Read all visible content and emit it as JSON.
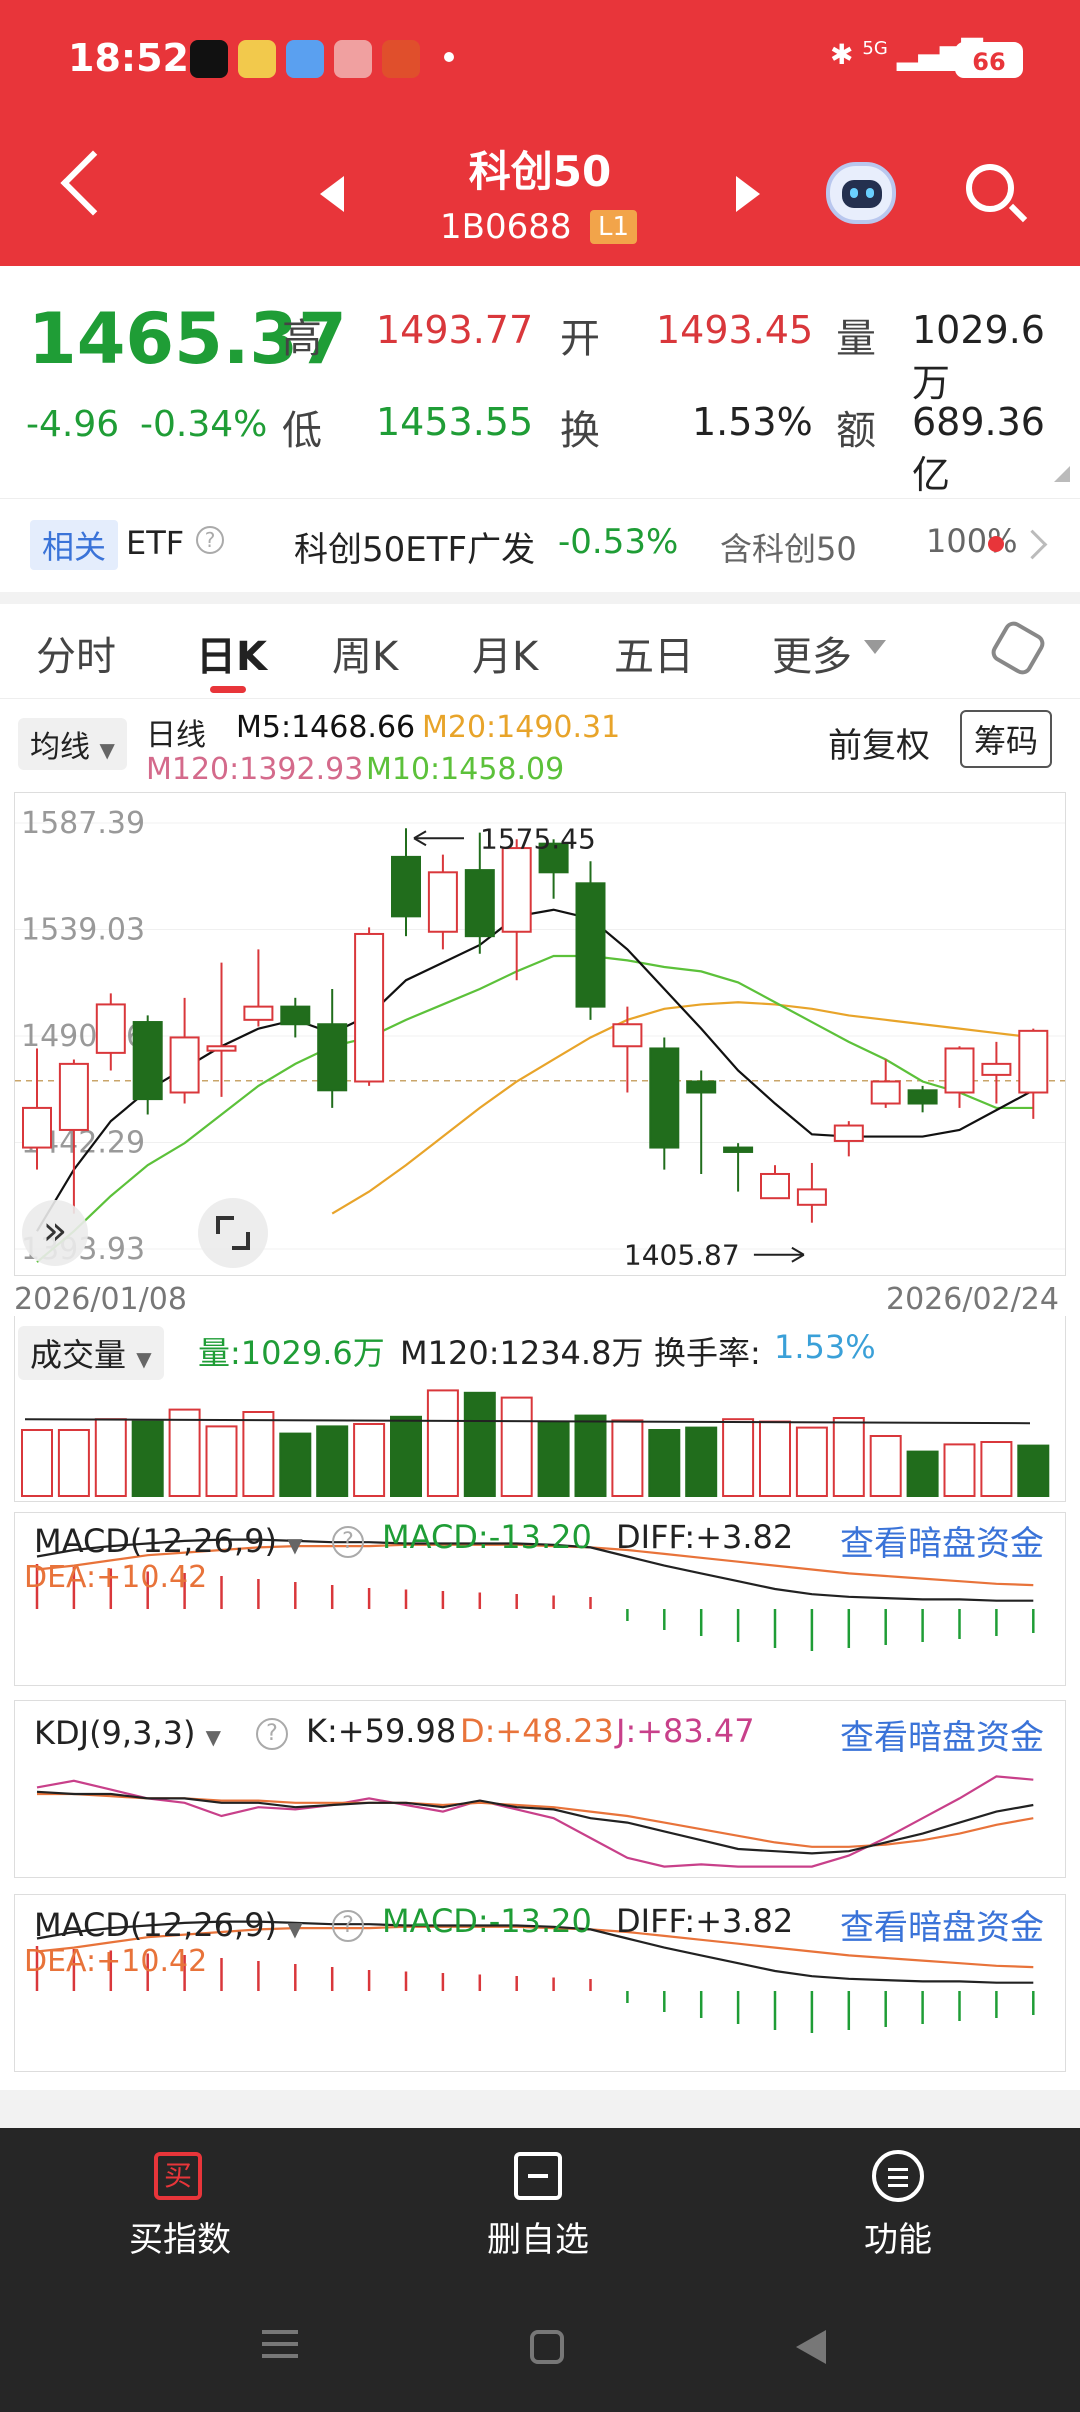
{
  "status": {
    "time": "18:52",
    "network": "5G",
    "battery": "66"
  },
  "header": {
    "title": "科创50",
    "code": "1B0688",
    "level": "L1"
  },
  "quote": {
    "price": "1465.37",
    "change": "-4.96",
    "change_pct": "-0.34%",
    "high_label": "高",
    "high": "1493.77",
    "open_label": "开",
    "open": "1493.45",
    "volume_label": "量",
    "volume": "1029.6万",
    "low_label": "低",
    "low": "1453.55",
    "turnover_label": "换",
    "turnover": "1.53%",
    "amount_label": "额",
    "amount": "689.36亿"
  },
  "etf": {
    "tag": "相关",
    "etf_label": "ETF",
    "name": "科创50ETF广发",
    "change": "-0.53%",
    "contains": "含科创50",
    "contains_pct": "100%"
  },
  "tabs": [
    "分时",
    "日K",
    "周K",
    "月K",
    "五日",
    "更多"
  ],
  "ma": {
    "selector": "均线",
    "period": "日线",
    "m5": "M5:1468.66",
    "m20": "M20:1490.31",
    "m120": "M120:1392.93",
    "m10": "M10:1458.09",
    "adj": "前复权",
    "chips": "筹码"
  },
  "colors": {
    "up": "#d9373b",
    "down": "#216d1c",
    "m5": "#111111",
    "m10": "#5cc13a",
    "m20": "#e8a42a",
    "m120": "#d46a8b",
    "header": "#e8353a"
  },
  "kline": {
    "start_date": "2026/01/08",
    "end_date": "2026/02/24",
    "high_mark": "1575.45",
    "low_mark": "1405.87"
  },
  "volume": {
    "selector": "成交量",
    "vol": "量:1029.6万",
    "m120": "M120:1234.8万",
    "turnover_label": "换手率:",
    "turnover": "1.53%"
  },
  "macd": {
    "selector": "MACD(12,26,9)",
    "macd": "MACD:-13.20",
    "diff": "DIFF:+3.82",
    "dea": "DEA:+10.42",
    "link": "查看暗盘资金"
  },
  "kdj": {
    "selector": "KDJ(9,3,3)",
    "k": "K:+59.98",
    "d": "D:+48.23",
    "j": "J:+83.47",
    "link": "查看暗盘资金"
  },
  "bottom_nav": {
    "buy_icon": "买",
    "buy": "买指数",
    "remove": "删自选",
    "func": "功能"
  },
  "chart_data": {
    "type": "candlestick",
    "x_start": "2026/01/08",
    "x_end": "2026/02/24",
    "y_ticks": [
      1587.39,
      1539.03,
      1490.66,
      1442.29,
      1393.93
    ],
    "ylim": [
      1393.93,
      1587.39
    ],
    "reference_price": 1470.33,
    "candles": [
      {
        "o": 1440,
        "c": 1458,
        "h": 1485,
        "l": 1430
      },
      {
        "o": 1448,
        "c": 1478,
        "h": 1480,
        "l": 1410
      },
      {
        "o": 1483,
        "c": 1505,
        "h": 1510,
        "l": 1475
      },
      {
        "o": 1497,
        "c": 1462,
        "h": 1500,
        "l": 1455
      },
      {
        "o": 1465,
        "c": 1490,
        "h": 1508,
        "l": 1460
      },
      {
        "o": 1484,
        "c": 1486,
        "h": 1524,
        "l": 1463
      },
      {
        "o": 1498,
        "c": 1504,
        "h": 1530,
        "l": 1495
      },
      {
        "o": 1504,
        "c": 1496,
        "h": 1508,
        "l": 1490
      },
      {
        "o": 1496,
        "c": 1466,
        "h": 1512,
        "l": 1458
      },
      {
        "o": 1470,
        "c": 1537,
        "h": 1540,
        "l": 1468
      },
      {
        "o": 1572,
        "c": 1545,
        "h": 1585,
        "l": 1536
      },
      {
        "o": 1538,
        "c": 1565,
        "h": 1573,
        "l": 1530
      },
      {
        "o": 1566,
        "c": 1536,
        "h": 1583,
        "l": 1528
      },
      {
        "o": 1538,
        "c": 1576,
        "h": 1580,
        "l": 1516
      },
      {
        "o": 1578,
        "c": 1565,
        "h": 1580,
        "l": 1553
      },
      {
        "o": 1560,
        "c": 1504,
        "h": 1570,
        "l": 1498
      },
      {
        "o": 1486,
        "c": 1496,
        "h": 1504,
        "l": 1465
      },
      {
        "o": 1485,
        "c": 1440,
        "h": 1490,
        "l": 1430
      },
      {
        "o": 1470,
        "c": 1465,
        "h": 1475,
        "l": 1428
      },
      {
        "o": 1440,
        "c": 1438,
        "h": 1442,
        "l": 1420
      },
      {
        "o": 1417,
        "c": 1428,
        "h": 1432,
        "l": 1417
      },
      {
        "o": 1414,
        "c": 1421,
        "h": 1433,
        "l": 1405.87
      },
      {
        "o": 1443,
        "c": 1450,
        "h": 1452,
        "l": 1436
      },
      {
        "o": 1460,
        "c": 1470,
        "h": 1480,
        "l": 1458
      },
      {
        "o": 1466,
        "c": 1460,
        "h": 1468,
        "l": 1456
      },
      {
        "o": 1465,
        "c": 1485,
        "h": 1486,
        "l": 1458
      },
      {
        "o": 1473,
        "c": 1478,
        "h": 1488,
        "l": 1460
      },
      {
        "o": 1465,
        "c": 1493,
        "h": 1494,
        "l": 1453
      }
    ],
    "ma5": [
      1402,
      1430,
      1452,
      1466,
      1476,
      1486,
      1494,
      1498,
      1492,
      1500,
      1516,
      1524,
      1532,
      1545,
      1548,
      1544,
      1530,
      1512,
      1494,
      1475,
      1460,
      1446,
      1445,
      1445,
      1445,
      1448,
      1457,
      1466
    ],
    "ma10": [
      1388,
      1402,
      1418,
      1432,
      1442,
      1455,
      1468,
      1478,
      1486,
      1490,
      1498,
      1505,
      1512,
      1520,
      1527,
      1527,
      1525,
      1522,
      1520,
      1515,
      1506,
      1497,
      1488,
      1480,
      1470,
      1465,
      1458,
      1458
    ],
    "ma20": [
      null,
      null,
      null,
      null,
      null,
      null,
      null,
      null,
      1410,
      1420,
      1432,
      1445,
      1458,
      1470,
      1480,
      1490,
      1498,
      1503,
      1505,
      1506,
      1505,
      1503,
      1500,
      1498,
      1496,
      1494,
      1492,
      1490
    ],
    "volume": [
      {
        "v": 55,
        "up": true
      },
      {
        "v": 55,
        "up": true
      },
      {
        "v": 64,
        "up": true
      },
      {
        "v": 62,
        "up": false
      },
      {
        "v": 72,
        "up": true
      },
      {
        "v": 58,
        "up": true
      },
      {
        "v": 70,
        "up": true
      },
      {
        "v": 52,
        "up": false
      },
      {
        "v": 58,
        "up": false
      },
      {
        "v": 60,
        "up": true
      },
      {
        "v": 66,
        "up": false
      },
      {
        "v": 88,
        "up": true
      },
      {
        "v": 86,
        "up": false
      },
      {
        "v": 82,
        "up": true
      },
      {
        "v": 62,
        "up": false
      },
      {
        "v": 67,
        "up": false
      },
      {
        "v": 63,
        "up": true
      },
      {
        "v": 55,
        "up": false
      },
      {
        "v": 57,
        "up": false
      },
      {
        "v": 64,
        "up": true
      },
      {
        "v": 62,
        "up": true
      },
      {
        "v": 57,
        "up": true
      },
      {
        "v": 65,
        "up": true
      },
      {
        "v": 50,
        "up": true
      },
      {
        "v": 37,
        "up": false
      },
      {
        "v": 43,
        "up": true
      },
      {
        "v": 45,
        "up": true
      },
      {
        "v": 42,
        "up": false
      }
    ],
    "vol_m120": 1234.8,
    "macd_hist": [
      30,
      28,
      27,
      25,
      24,
      22,
      20,
      18,
      16,
      14,
      13,
      12,
      11,
      10,
      9,
      8,
      -8,
      -14,
      -18,
      -22,
      -26,
      -28,
      -26,
      -24,
      -22,
      -20,
      -18,
      -16
    ],
    "macd_diff": [
      25,
      30,
      33,
      35,
      37,
      38,
      38,
      37,
      36,
      36,
      35,
      35,
      35,
      35,
      34,
      32,
      25,
      18,
      12,
      6,
      0,
      -4,
      -6,
      -7,
      -8,
      -8,
      -9,
      -9
    ],
    "macd_dea": [
      15,
      18,
      22,
      26,
      28,
      30,
      32,
      33,
      33,
      33,
      34,
      34,
      34,
      34,
      33,
      32,
      30,
      27,
      24,
      21,
      18,
      15,
      12,
      10,
      8,
      6,
      4,
      3
    ],
    "kdj_k": [
      72,
      70,
      70,
      66,
      66,
      62,
      62,
      58,
      60,
      62,
      62,
      58,
      64,
      58,
      56,
      48,
      44,
      36,
      28,
      20,
      18,
      16,
      18,
      26,
      34,
      44,
      54,
      60
    ],
    "kdj_d": [
      70,
      70,
      68,
      66,
      66,
      64,
      64,
      62,
      62,
      62,
      62,
      60,
      62,
      60,
      58,
      54,
      50,
      44,
      38,
      32,
      26,
      22,
      22,
      24,
      28,
      34,
      42,
      48
    ],
    "kdj_j": [
      76,
      82,
      74,
      66,
      62,
      50,
      58,
      56,
      60,
      66,
      60,
      54,
      64,
      56,
      48,
      30,
      12,
      4,
      6,
      4,
      4,
      4,
      14,
      30,
      48,
      66,
      86,
      83
    ]
  }
}
